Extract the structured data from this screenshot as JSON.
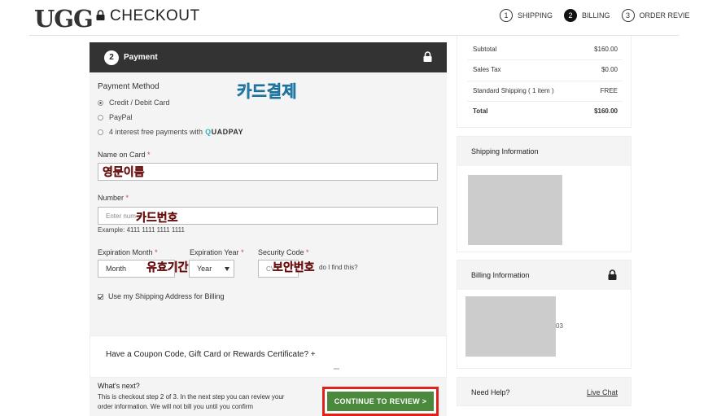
{
  "header": {
    "logo": "UGG",
    "title": "CHECKOUT",
    "steps": [
      {
        "num": "1",
        "label": "SHIPPING",
        "active": false
      },
      {
        "num": "2",
        "label": "BILLING",
        "active": true
      },
      {
        "num": "3",
        "label": "ORDER REVIE",
        "active": false
      }
    ]
  },
  "payment": {
    "step_num": "2",
    "title": "Payment",
    "method_label": "Payment Method",
    "methods": [
      {
        "label": "Credit / Debit Card",
        "checked": true
      },
      {
        "label": "PayPal",
        "checked": false
      },
      {
        "label": "4 interest free payments with",
        "checked": false
      }
    ],
    "quadpay_q": "Q",
    "quadpay_rest": "UADPAY",
    "name_label": "Name on Card",
    "number_label": "Number",
    "number_placeholder": "Enter num",
    "number_example": "Example: 4111 1111 1111 1111",
    "exp_month_label": "Expiration Month",
    "exp_month_value": "Month",
    "exp_year_label": "Expiration Year",
    "exp_year_value": "Year",
    "security_label": "Security Code",
    "security_placeholder": "CV",
    "security_help": "do I find this?",
    "required_mark": "*",
    "use_shipping_label": "Use my Shipping Address for Billing"
  },
  "annotations": {
    "card_payment": "카드결제",
    "english_name": "영문이름",
    "card_number": "카드번호",
    "expiry": "유효기간",
    "security_number": "보안번호"
  },
  "coupon": {
    "text": "Have a Coupon Code, Gift Card or Rewards Certificate? +"
  },
  "footer": {
    "whats_next": "What's next?",
    "description": "This is checkout step 2 of 3. In the next step you can review your order information. We will not bill you until you confirm",
    "continue_label": "CONTINUE TO REVIEW >"
  },
  "summary": {
    "rows": [
      {
        "label": "Subtotal",
        "value": "$160.00"
      },
      {
        "label": "Sales Tax",
        "value": "$0.00"
      },
      {
        "label": "Standard Shipping ( 1 item )",
        "value": "FREE"
      },
      {
        "label": "Total",
        "value": "$160.00"
      }
    ]
  },
  "shipping_info": {
    "title": "Shipping Information"
  },
  "billing_info": {
    "title": "Billing Information",
    "fragment": "03"
  },
  "help": {
    "title": "Need Help?",
    "live_chat": "Live Chat"
  },
  "colors": {
    "dark_bar": "#333333",
    "panel_bg": "#f4f4f4",
    "continue_green": "#4b8a3d",
    "highlight_red": "#e0221c",
    "annotation_blue": "#3aa8dc",
    "annotation_red": "#cc1f1f"
  },
  "icons": [
    "lock-icon",
    "radio-icon",
    "checkbox-icon",
    "caret-down-icon"
  ]
}
